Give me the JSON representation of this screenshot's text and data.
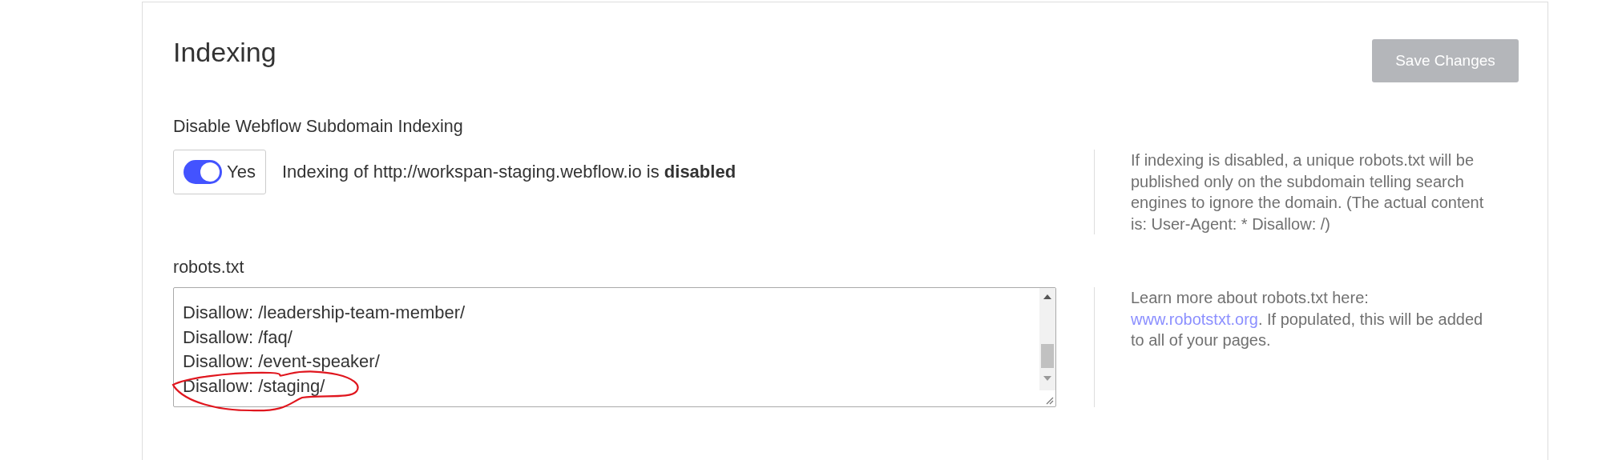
{
  "header": {
    "title": "Indexing",
    "save_button": {
      "label": "Save Changes",
      "disabled": true
    }
  },
  "subdomain_indexing": {
    "label": "Disable Webflow Subdomain Indexing",
    "toggle": {
      "on": true,
      "label": "Yes"
    },
    "status": "Indexing of http://workspan-staging.webflow.io is **disabled**",
    "help": "If indexing is disabled, a unique robots.txt will be published only on the subdomain telling search engines to ignore the domain. (The actual content is: User-Agent: * Disallow: /)"
  },
  "robots": {
    "label": "robots.txt",
    "lines": [
      "Disallow: /leadership-team-member/",
      "Disallow: /faq/",
      "Disallow: /event-speaker/",
      "Disallow: /staging/"
    ],
    "help": {
      "before": "Learn more about robots.txt here:",
      "link": "www.robotstxt.org",
      "after": ". If populated, this will be added to all of your pages."
    }
  }
}
